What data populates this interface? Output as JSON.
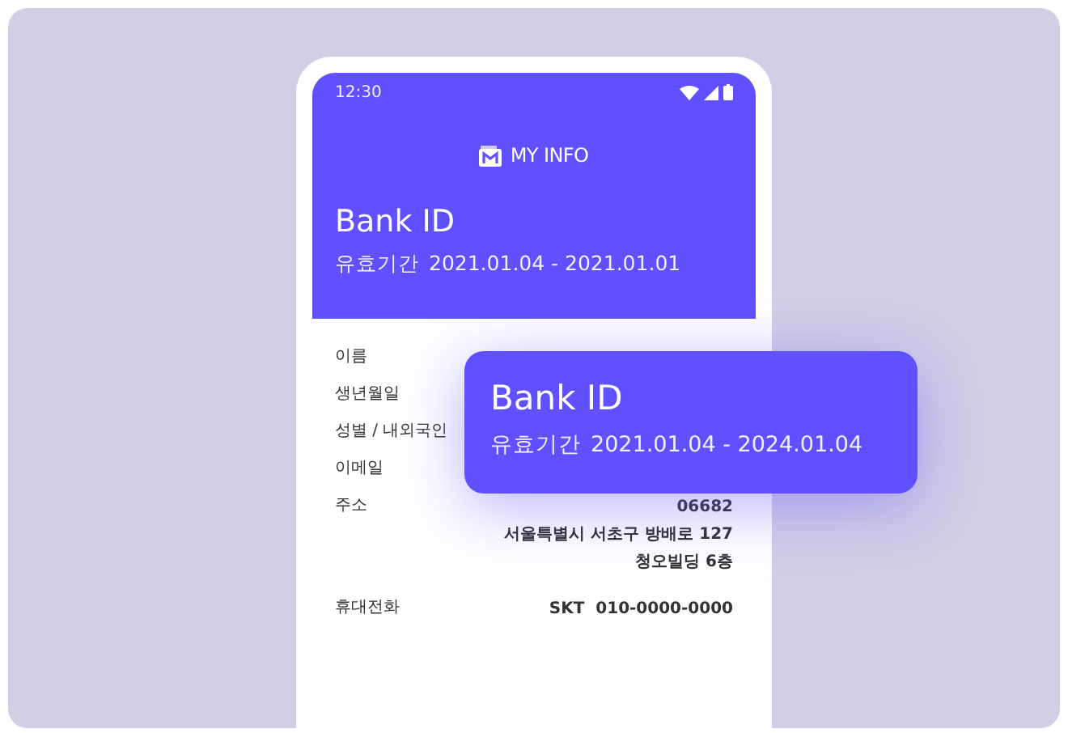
{
  "status_bar": {
    "time": "12:30"
  },
  "header": {
    "logo_text": "MY INFO"
  },
  "card": {
    "title": "Bank ID",
    "validity_label": "유효기간",
    "validity": "2021.01.04 - 2021.01.01"
  },
  "fields": [
    {
      "label": "이름"
    },
    {
      "label": "생년월일"
    },
    {
      "label": "성별 / 내외국인"
    },
    {
      "label": "이메일"
    },
    {
      "label": "주소",
      "value_lines": [
        "06682",
        "서울특별시 서초구 방배로 127",
        "청오빌딩 6층"
      ]
    },
    {
      "label": "휴대전화",
      "value_lines": [
        "SKT  010-0000-0000"
      ]
    }
  ],
  "overlay_card": {
    "title": "Bank ID",
    "validity_label": "유효기간",
    "validity": "2021.01.04 - 2024.01.04"
  }
}
